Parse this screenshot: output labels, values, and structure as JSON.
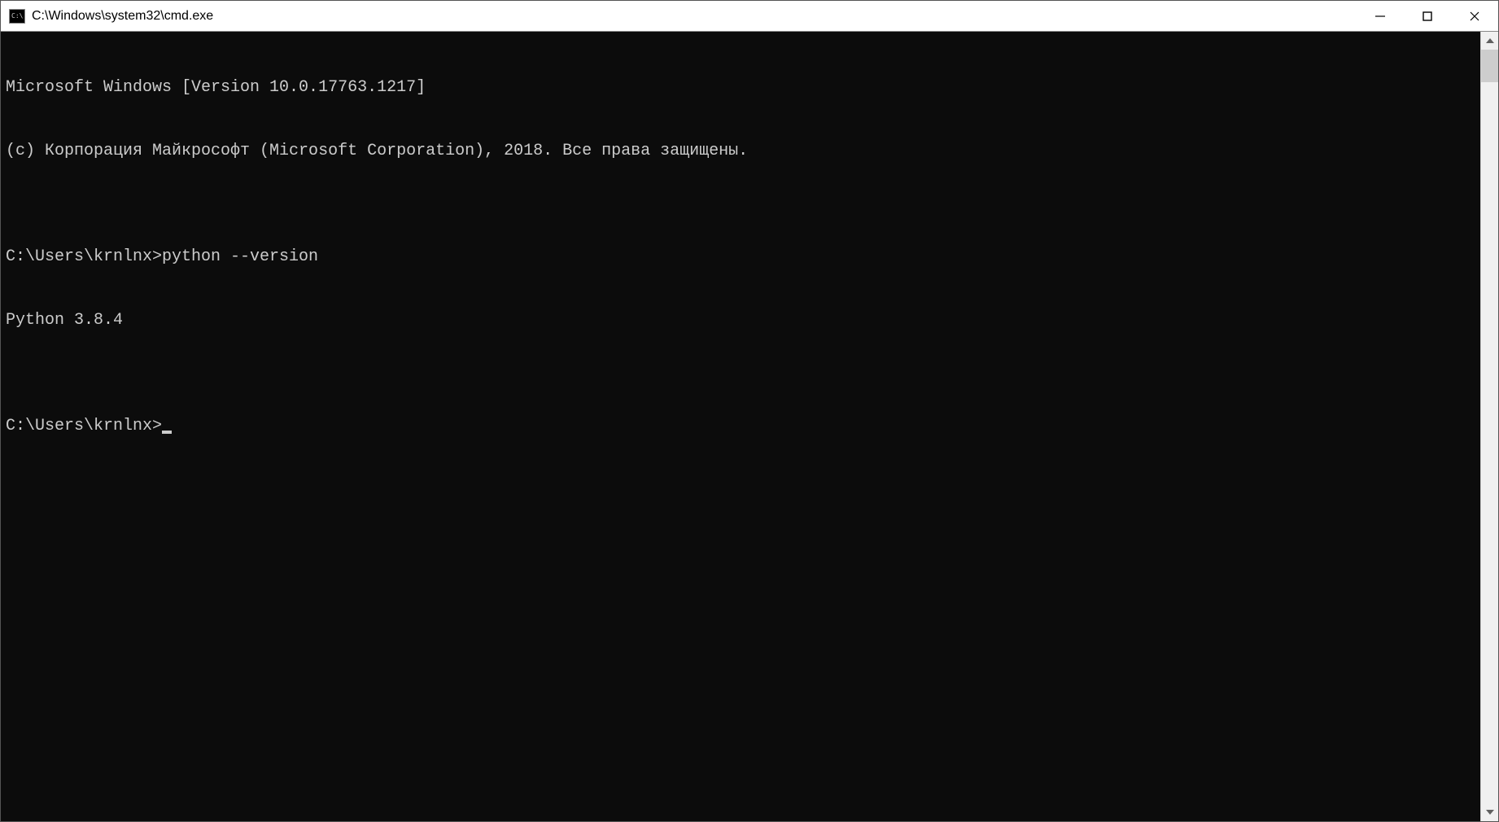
{
  "window": {
    "title": "C:\\Windows\\system32\\cmd.exe"
  },
  "terminal": {
    "lines": {
      "banner1": "Microsoft Windows [Version 10.0.17763.1217]",
      "banner2": "(c) Корпорация Майкрософт (Microsoft Corporation), 2018. Все права защищены.",
      "blank1": "",
      "prompt1": "C:\\Users\\krnlnx>",
      "command1": "python --version",
      "output1": "Python 3.8.4",
      "blank2": "",
      "prompt2": "C:\\Users\\krnlnx>"
    }
  }
}
